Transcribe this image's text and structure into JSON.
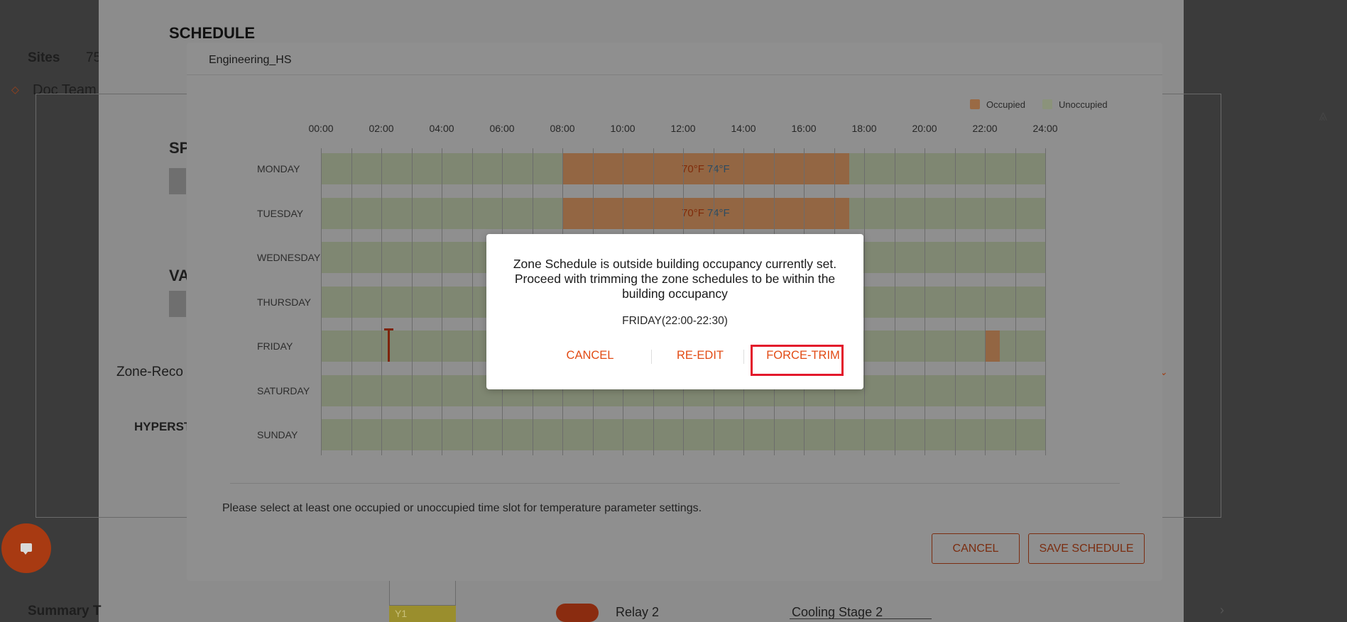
{
  "background": {
    "sites_label": "Sites",
    "sites_count": "75",
    "team": "Doc Team",
    "schedule_heading": "SCHEDULE",
    "sp_heading": "SP",
    "va_heading": "VA",
    "zone_label": "Zone-Reco",
    "hyper_label": "HYPERST",
    "summary_label": "Summary T",
    "relay_label": "Relay 2",
    "cooling_select": "Cooling Stage 2",
    "y1_label": "Y1"
  },
  "modal": {
    "title": "Engineering_HS",
    "legend": {
      "occupied": "Occupied",
      "unoccupied": "Unoccupied",
      "occupied_color": "#E8A26E",
      "unoccupied_color": "#D8E6C6"
    },
    "time_ticks": [
      "00:00",
      "02:00",
      "04:00",
      "06:00",
      "08:00",
      "10:00",
      "12:00",
      "14:00",
      "16:00",
      "18:00",
      "20:00",
      "22:00",
      "24:00"
    ],
    "days": [
      "MONDAY",
      "TUESDAY",
      "WEDNESDAY",
      "THURSDAY",
      "FRIDAY",
      "SATURDAY",
      "SUNDAY"
    ],
    "occupied_slots": [
      {
        "day": "MONDAY",
        "start": "08:00",
        "end": "17:30",
        "heat": "70°F",
        "cool": "74°F"
      },
      {
        "day": "TUESDAY",
        "start": "08:00",
        "end": "17:30",
        "heat": "70°F",
        "cool": "74°F"
      },
      {
        "day": "FRIDAY",
        "start": "22:00",
        "end": "22:30"
      }
    ],
    "note": "Please select at least one occupied or unoccupied time slot for temperature parameter settings.",
    "cancel_label": "CANCEL",
    "save_label": "SAVE SCHEDULE"
  },
  "dialog": {
    "message": "Zone Schedule is outside building occupancy currently set. Proceed with trimming the zone schedules to be within the building occupancy",
    "detail": "FRIDAY(22:00-22:30)",
    "cancel_label": "CANCEL",
    "reedit_label": "RE-EDIT",
    "force_trim_label": "FORCE-TRIM"
  },
  "colors": {
    "accent": "#E24B14",
    "highlight_box": "#E3182B"
  }
}
